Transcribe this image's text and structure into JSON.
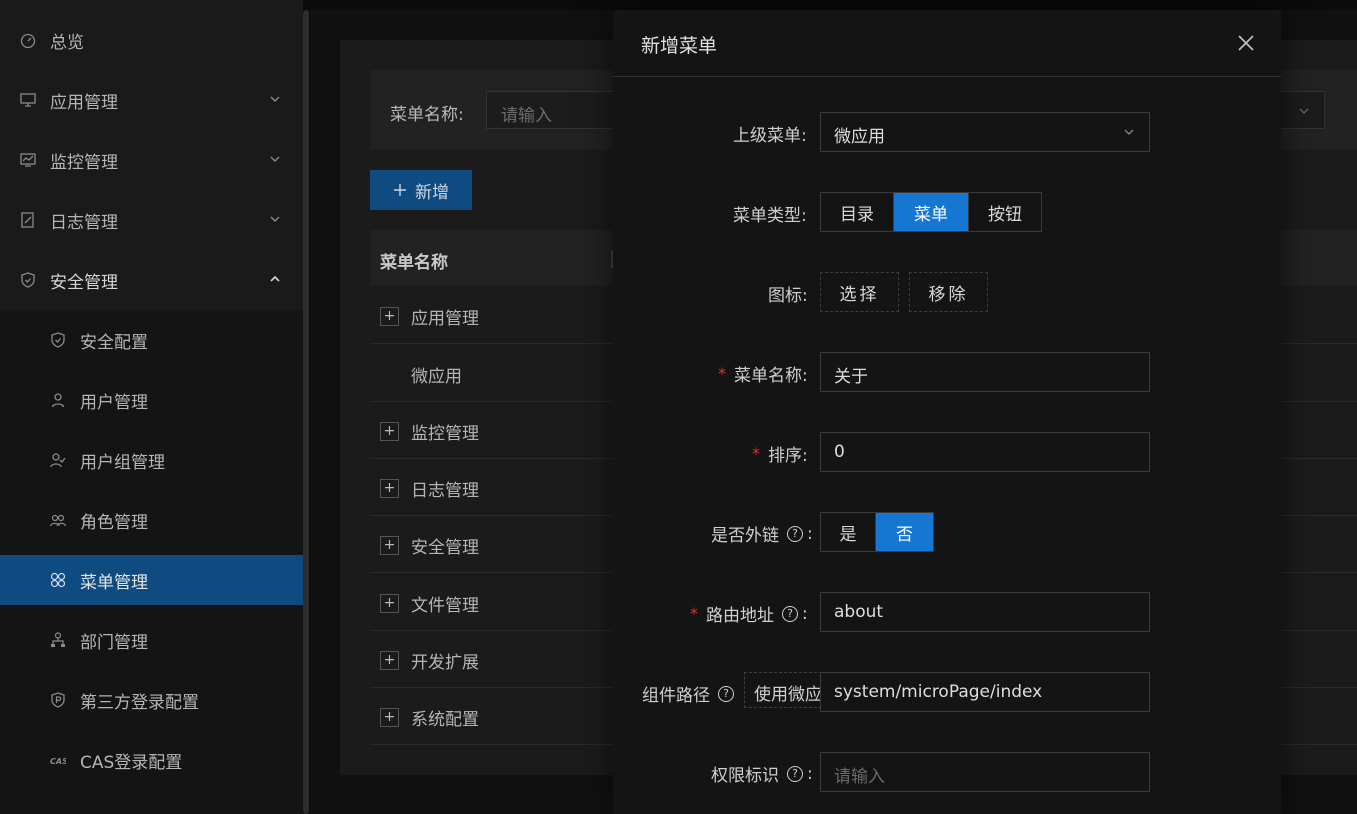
{
  "sidebar": {
    "items": [
      {
        "label": "总览",
        "icon": "dashboard-icon"
      },
      {
        "label": "应用管理",
        "icon": "monitor-icon"
      },
      {
        "label": "监控管理",
        "icon": "chart-icon"
      },
      {
        "label": "日志管理",
        "icon": "edit-icon"
      },
      {
        "label": "安全管理",
        "icon": "shield-icon"
      }
    ],
    "sub_items": [
      {
        "label": "安全配置",
        "icon": "shield-icon"
      },
      {
        "label": "用户管理",
        "icon": "user-icon"
      },
      {
        "label": "用户组管理",
        "icon": "user-group-icon"
      },
      {
        "label": "角色管理",
        "icon": "team-icon"
      },
      {
        "label": "菜单管理",
        "icon": "menu-grid-icon"
      },
      {
        "label": "部门管理",
        "icon": "org-icon"
      },
      {
        "label": "第三方登录配置",
        "icon": "shield-p-icon"
      },
      {
        "label": "CAS登录配置",
        "icon": "cas-icon"
      }
    ],
    "active_color": "#0f4a80"
  },
  "main": {
    "search_label": "菜单名称:",
    "search_placeholder": "请输入",
    "add_button": "新增",
    "table_header": "菜单名称",
    "rows": [
      "应用管理",
      "微应用",
      "监控管理",
      "日志管理",
      "安全管理",
      "文件管理",
      "开发扩展",
      "系统配置"
    ]
  },
  "modal": {
    "title": "新增菜单",
    "parent_label": "上级菜单:",
    "parent_value": "微应用",
    "type_label": "菜单类型:",
    "type_options": [
      "目录",
      "菜单",
      "按钮"
    ],
    "type_selected": "菜单",
    "icon_label": "图标:",
    "icon_select": "选择",
    "icon_remove": "移除",
    "name_label": "菜单名称:",
    "name_value": "关于",
    "order_label": "排序:",
    "order_value": "0",
    "external_label": "是否外链",
    "external_yes": "是",
    "external_no": "否",
    "external_selected": "否",
    "route_label": "路由地址",
    "route_value": "about",
    "component_label": "组件路径",
    "component_micro_btn": "使用微应",
    "component_value": "system/microPage/index",
    "perm_label": "权限标识",
    "perm_placeholder": "请输入",
    "accent_color": "#1677d2",
    "required_color": "#d0383a"
  }
}
